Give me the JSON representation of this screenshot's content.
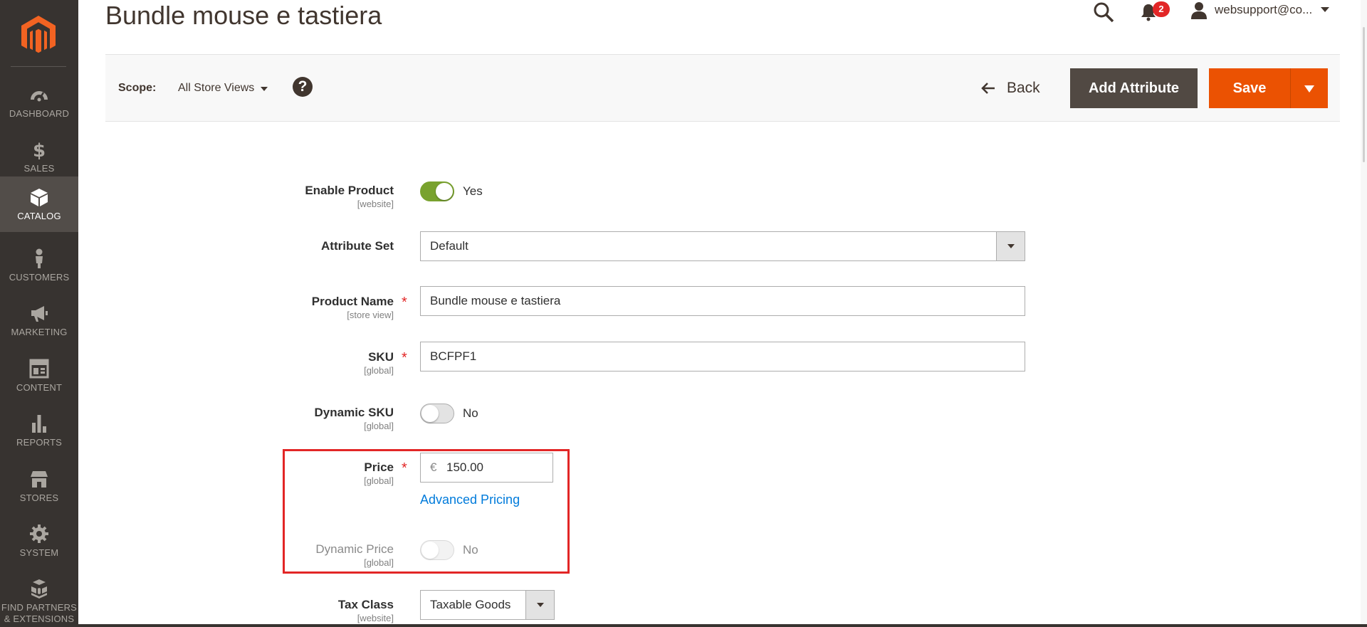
{
  "sidebar": {
    "items": [
      {
        "label": "DASHBOARD",
        "icon": "dashboard-icon"
      },
      {
        "label": "SALES",
        "icon": "dollar-icon"
      },
      {
        "label": "CATALOG",
        "icon": "box-icon",
        "active": true
      },
      {
        "label": "CUSTOMERS",
        "icon": "person-icon"
      },
      {
        "label": "MARKETING",
        "icon": "megaphone-icon"
      },
      {
        "label": "CONTENT",
        "icon": "layout-icon"
      },
      {
        "label": "REPORTS",
        "icon": "bar-chart-icon"
      },
      {
        "label": "STORES",
        "icon": "store-icon"
      },
      {
        "label": "SYSTEM",
        "icon": "gear-icon"
      },
      {
        "label_line1": "FIND PARTNERS",
        "label_line2": "& EXTENSIONS",
        "icon": "cubes-icon"
      }
    ]
  },
  "header": {
    "title": "Bundle mouse e tastiera",
    "notifications_count": "2",
    "user": "websupport@co..."
  },
  "toolbar": {
    "scope_label": "Scope:",
    "scope_value": "All Store Views",
    "help": "?",
    "back_label": "Back",
    "add_attribute_label": "Add Attribute",
    "save_label": "Save"
  },
  "form": {
    "enable_product": {
      "label": "Enable Product",
      "scope": "[website]",
      "value": "Yes",
      "enabled": true
    },
    "attribute_set": {
      "label": "Attribute Set",
      "value": "Default"
    },
    "product_name": {
      "label": "Product Name",
      "scope": "[store view]",
      "value": "Bundle mouse e tastiera",
      "required": true
    },
    "sku": {
      "label": "SKU",
      "scope": "[global]",
      "value": "BCFPF1",
      "required": true
    },
    "dynamic_sku": {
      "label": "Dynamic SKU",
      "scope": "[global]",
      "value": "No",
      "enabled": false
    },
    "price": {
      "label": "Price",
      "scope": "[global]",
      "currency": "€",
      "value": "150.00",
      "required": true,
      "advanced_link": "Advanced Pricing"
    },
    "dynamic_price": {
      "label": "Dynamic Price",
      "scope": "[global]",
      "value": "No",
      "enabled": false,
      "disabled": true
    },
    "tax_class": {
      "label": "Tax Class",
      "scope": "[website]",
      "value": "Taxable Goods"
    },
    "required_mark": "*"
  },
  "colors": {
    "sidebar_bg": "#373330",
    "accent_orange": "#eb5202",
    "toggle_on": "#79a22e",
    "link_blue": "#007bdb",
    "highlight_red": "#e22626"
  }
}
